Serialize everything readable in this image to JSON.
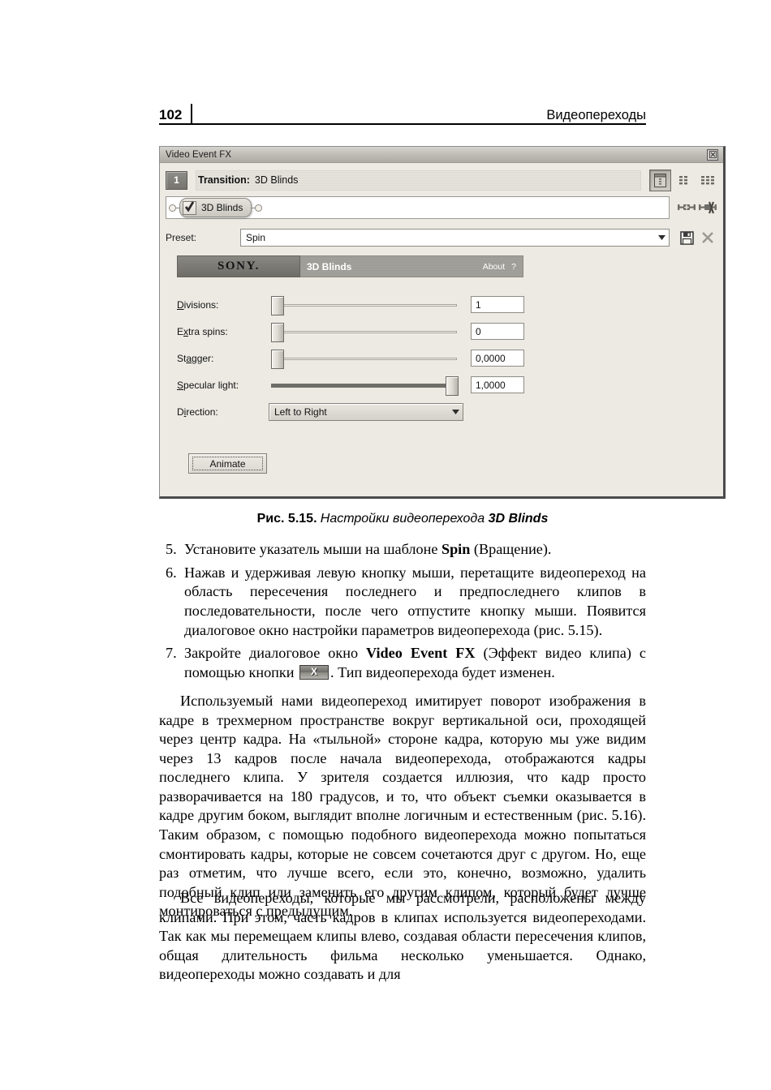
{
  "page": {
    "number": "102",
    "running_head": "Видеопереходы"
  },
  "figure": {
    "window": {
      "title": "Video Event FX",
      "close_icon": "close-icon",
      "transition": {
        "chain_number": "1",
        "label": "Transition:",
        "value": "3D Blinds"
      },
      "view_buttons": [
        "panel-view-button",
        "small-grid-view-button",
        "large-grid-view-button"
      ],
      "chain": {
        "plugin_name": "3D Blinds",
        "checkbox_checked": true,
        "add_icon": "add-plugin-icon",
        "remove_icon": "remove-plugin-icon"
      },
      "preset": {
        "label": "Preset:",
        "value": "Spin",
        "dropdown_icon": "chevron-down-icon",
        "save_icon": "save-preset-icon",
        "delete_icon": "delete-preset-icon"
      },
      "plugin_panel": {
        "brand": "SONY.",
        "name": "3D Blinds",
        "about": "About",
        "help": "?",
        "params": [
          {
            "label_pre": "D",
            "label_key": "i",
            "label_post": "visions:",
            "label": "Divisions:",
            "value": "1",
            "fill_pct": 0
          },
          {
            "label_pre": "E",
            "label_key": "x",
            "label_post": "tra spins:",
            "label": "Extra spins:",
            "value": "0",
            "fill_pct": 0
          },
          {
            "label_pre": "St",
            "label_key": "a",
            "label_post": "gger:",
            "label": "Stagger:",
            "value": "0,0000",
            "fill_pct": 0
          },
          {
            "label_pre": "",
            "label_key": "S",
            "label_post": "pecular light:",
            "label": "Specular light:",
            "value": "1,0000",
            "fill_pct": 100
          }
        ],
        "direction": {
          "label_pre": "D",
          "label_key": "i",
          "label_post": "rection:",
          "label": "Direction:",
          "value": "Left to Right"
        },
        "animate_button": "Animate"
      }
    },
    "caption_prefix": "Рис. 5.15.",
    "caption_text": "Настройки видеоперехода ",
    "caption_bold": "3D Blinds"
  },
  "steps": [
    {
      "num": "5.",
      "html": "Установите указатель мыши на шаблоне <b>Spin</b> (Вращение)."
    },
    {
      "num": "6.",
      "html": "Нажав и удерживая левую кнопку мыши, перетащите видеопереход на область пересечения последнего и предпоследнего клипов в последовательности, после чего отпустите кнопку мыши. Появится диалоговое окно настройки параметров видеоперехода (рис. 5.15)."
    },
    {
      "num": "7.",
      "html": "Закройте диалоговое окно <b>Video Event FX</b> (Эффект видео клипа) с помощью кнопки <span class=\"inline-x-btn\" data-name=\"close-window-button-inline\" data-interactable=\"false\"><span>X</span></span>. Тип видеоперехода будет изменен."
    }
  ],
  "paragraphs": [
    "Используемый нами видеопереход имитирует поворот изображения в кадре в трехмерном пространстве вокруг вертикальной оси, проходящей через центр кадра. На «тыльной» стороне кадра, которую мы уже видим через 13 кадров после начала видеоперехода, отображаются кадры последнего клипа. У зрителя создается иллюзия, что кадр просто разворачивается на 180 градусов, и то, что объект съемки оказывается в кадре другим боком, выглядит вполне логичным и естественным (рис. 5.16). Таким образом, с помощью подобного видеоперехода можно попытаться смонтировать кадры, которые не совсем сочетаются друг с другом. Но, еще раз отметим, что лучше всего, если это, конечно, возможно, удалить подобный клип или заменить его другим клипом, который будет лучше монтироваться с предыдущим.",
    "Все видеопереходы, которые мы рассмотрели, расположены между клипами. При этом, часть кадров в клипах используется видеопереходами. Так как мы перемещаем клипы влево, создавая области пересечения клипов, общая длительность фильма несколько уменьшается. Однако, видеопереходы можно создавать и для"
  ]
}
